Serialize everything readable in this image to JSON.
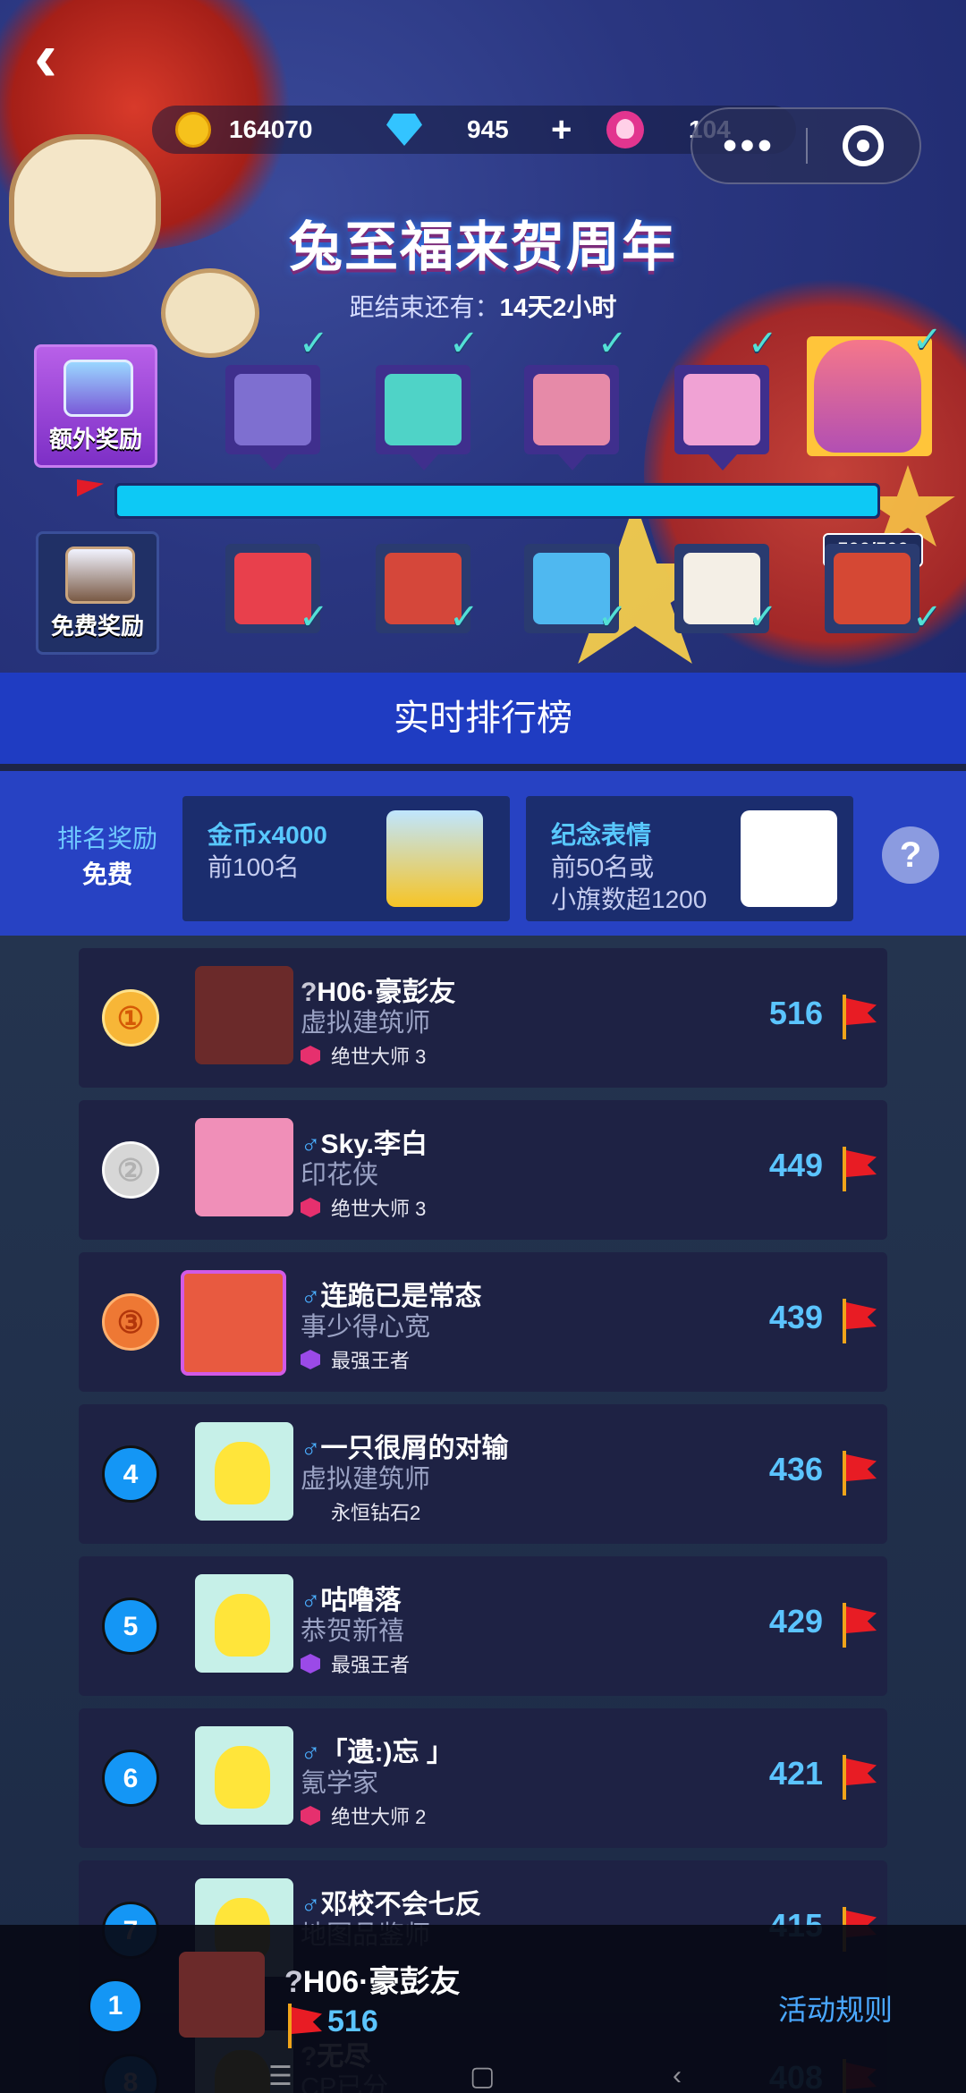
{
  "header": {
    "back_icon": "chevron-left-icon",
    "coins": "164070",
    "diamonds": "945",
    "plus": "+",
    "lotus": "104",
    "more_menu": "•••",
    "title": "兔至福来贺周年",
    "countdown_prefix": "距结束还有：",
    "countdown_value": "14天2小时"
  },
  "rewards": {
    "extra_label": "额外奖励",
    "free_label": "免费奖励",
    "progress_fraction": 1.0,
    "progress_text": "500/500",
    "top_tiles_colors": [
      "#7e6fd0",
      "#4fd3c7",
      "#e68aa8",
      "#f0a2d4"
    ],
    "bottom_tiles_colors": [
      "#e8404c",
      "#d5473a",
      "#4fb8f0",
      "#f4efe6",
      "#d54834"
    ],
    "check_glyph": "✓"
  },
  "board": {
    "title": "实时排行榜",
    "rank_reward_label": "排名奖励",
    "rank_reward_sub": "免费",
    "card1_title": "金币x4000",
    "card1_sub": "前100名",
    "card2_title": "纪念表情",
    "card2_sub_line1": "前50名或",
    "card2_sub_line2": "小旗数超1200",
    "help": "?"
  },
  "rows": [
    {
      "rank": "①",
      "badge": "gold",
      "prefix": "?",
      "prefix_type": "unk",
      "name": "H06·豪彭友",
      "title": "虚拟建筑师",
      "tier": "绝世大师 3",
      "tier_gem": "pink",
      "score": "516",
      "avatar": "#6b2a2a"
    },
    {
      "rank": "②",
      "badge": "silver",
      "prefix": "♂",
      "prefix_type": "sex",
      "name": "Sky.李白",
      "title": "印花侠",
      "tier": "绝世大师 3",
      "tier_gem": "pink",
      "score": "449",
      "avatar": "#f08fb8"
    },
    {
      "rank": "③",
      "badge": "bronze",
      "prefix": "♂",
      "prefix_type": "sex",
      "name": "连跪已是常态",
      "title": "事少得心宽",
      "tier": "最强王者",
      "tier_gem": "purple",
      "score": "439",
      "avatar": "#e85a40"
    },
    {
      "rank": "4",
      "badge": "num",
      "prefix": "♂",
      "prefix_type": "sex",
      "name": "一只很屑的对输",
      "title": "虚拟建筑师",
      "tier": "永恒钻石2",
      "tier_gem": "none",
      "score": "436",
      "avatar": "chick"
    },
    {
      "rank": "5",
      "badge": "num",
      "prefix": "♂",
      "prefix_type": "sex",
      "name": "咕噜落",
      "title": "恭贺新禧",
      "tier": "最强王者",
      "tier_gem": "purple",
      "score": "429",
      "avatar": "chick"
    },
    {
      "rank": "6",
      "badge": "num",
      "prefix": "♂",
      "prefix_type": "sex",
      "name": "「遗:)忘 」",
      "title": "氪学家",
      "tier": "绝世大师 2",
      "tier_gem": "pink",
      "score": "421",
      "avatar": "chick"
    },
    {
      "rank": "7",
      "badge": "num",
      "prefix": "♂",
      "prefix_type": "sex",
      "name": "邓校不会七反",
      "title": "地图品鉴师",
      "tier": "",
      "tier_gem": "none",
      "score": "415",
      "avatar": "chick"
    },
    {
      "rank": "8",
      "badge": "num",
      "prefix": "?",
      "prefix_type": "unk",
      "name": "无尽",
      "title": "CP已分",
      "tier": "",
      "tier_gem": "none",
      "score": "408",
      "avatar": "chick"
    }
  ],
  "me": {
    "rank": "1",
    "prefix": "?",
    "name": "H06·豪彭友",
    "score": "516",
    "rules_link": "活动规则"
  }
}
